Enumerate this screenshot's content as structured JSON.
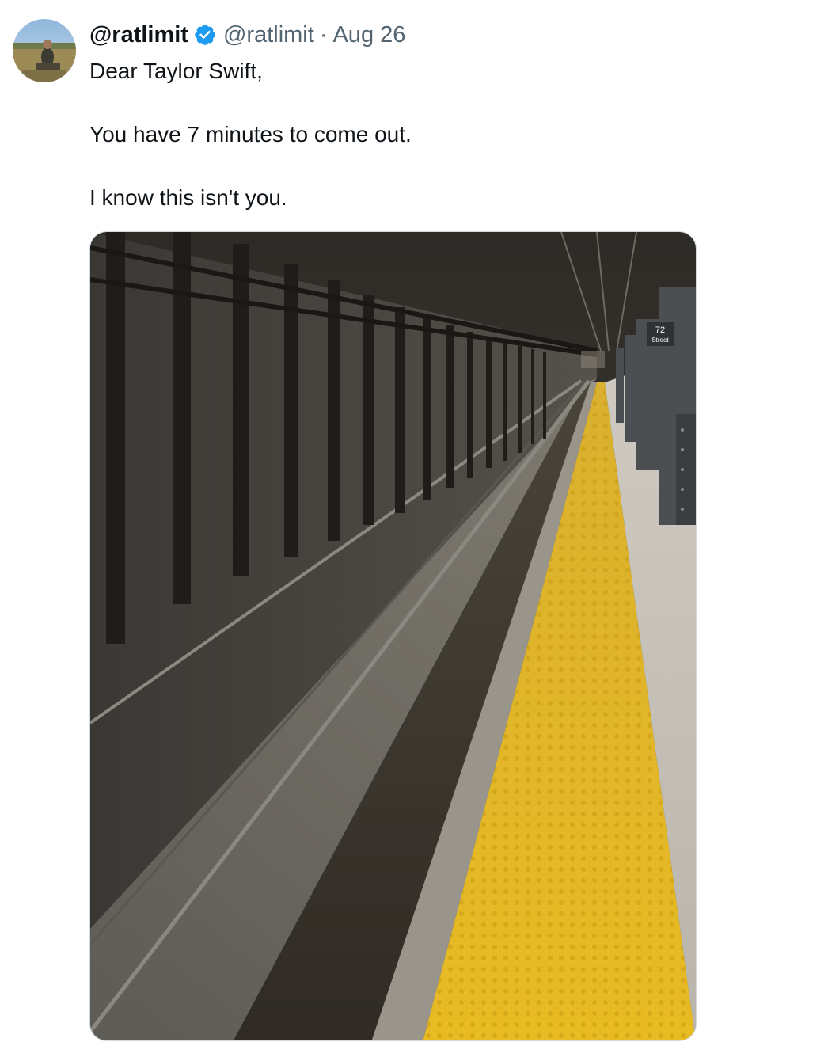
{
  "tweet": {
    "display_name": "@ratlimit",
    "handle": "@ratlimit",
    "separator": "·",
    "date": "Aug 26",
    "verified": true,
    "text_lines": [
      "Dear Taylor Swift,",
      "You have 7 minutes to come out.",
      "I know this isn't you."
    ]
  },
  "media": {
    "type": "photo",
    "sign_number": "72",
    "sign_word": "Street"
  },
  "icons": {
    "verified": "verified-badge-icon"
  },
  "colors": {
    "text_primary": "#0f1419",
    "text_secondary": "#536471",
    "verified_blue": "#1d9bf0",
    "tactile_yellow": "#e3b520"
  }
}
